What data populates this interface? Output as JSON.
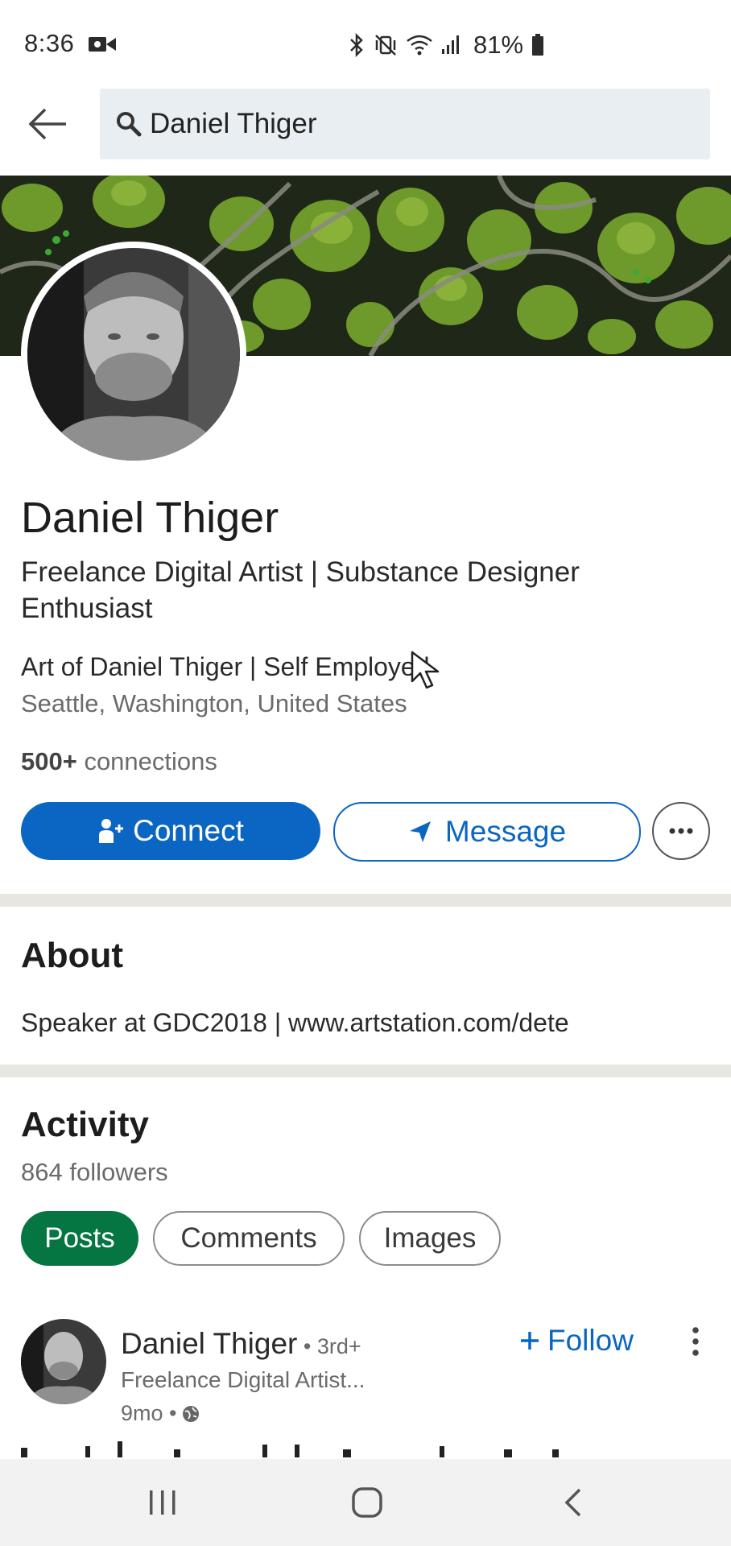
{
  "status_bar": {
    "time": "8:36",
    "battery": "81%",
    "icons": [
      "video-recording-icon",
      "bluetooth-icon",
      "vibrate-icon",
      "wifi-icon",
      "signal-icon",
      "battery-icon"
    ]
  },
  "search": {
    "query": "Daniel Thiger",
    "icon": "search-icon"
  },
  "profile": {
    "name": "Daniel Thiger",
    "headline": "Freelance Digital Artist | Substance Designer Enthusiast",
    "company": "Art of Daniel Thiger | Self Employed",
    "location": "Seattle, Washington, United States",
    "connections_count": "500+",
    "connections_label": " connections"
  },
  "actions": {
    "connect_label": "Connect",
    "message_label": "Message"
  },
  "about": {
    "title": "About",
    "text": "Speaker at GDC2018 | www.artstation.com/dete"
  },
  "activity": {
    "title": "Activity",
    "followers": "864 followers",
    "tabs": [
      {
        "label": "Posts",
        "active": true
      },
      {
        "label": "Comments",
        "active": false
      },
      {
        "label": "Images",
        "active": false
      }
    ]
  },
  "post": {
    "author": "Daniel Thiger",
    "degree": " • 3rd+",
    "subtitle": "Freelance Digital Artist...",
    "time": "9mo •",
    "follow_label": "Follow"
  },
  "colors": {
    "primary_blue": "#0a66c2",
    "active_green": "#057642",
    "divider": "#e8e6e1",
    "search_bg": "#e9eef2"
  }
}
